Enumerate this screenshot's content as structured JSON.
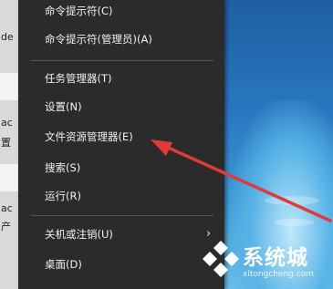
{
  "desktop": {
    "left_labels": [
      "de",
      "ac",
      "置",
      "ac",
      "产"
    ]
  },
  "menu": {
    "items": [
      {
        "label": "命令提示符(C)"
      },
      {
        "label": "命令提示符(管理员)(A)"
      },
      {
        "label": "任务管理器(T)"
      },
      {
        "label": "设置(N)"
      },
      {
        "label": "文件资源管理器(E)"
      },
      {
        "label": "搜索(S)"
      },
      {
        "label": "运行(R)"
      },
      {
        "label": "关机或注销(U)",
        "has_submenu": true
      },
      {
        "label": "桌面(D)"
      }
    ],
    "submenu_glyph": "›"
  },
  "annotation": {
    "arrow_color": "#e03a3a"
  },
  "watermark": {
    "title": "系统城",
    "url": "xitongcheng.com"
  }
}
